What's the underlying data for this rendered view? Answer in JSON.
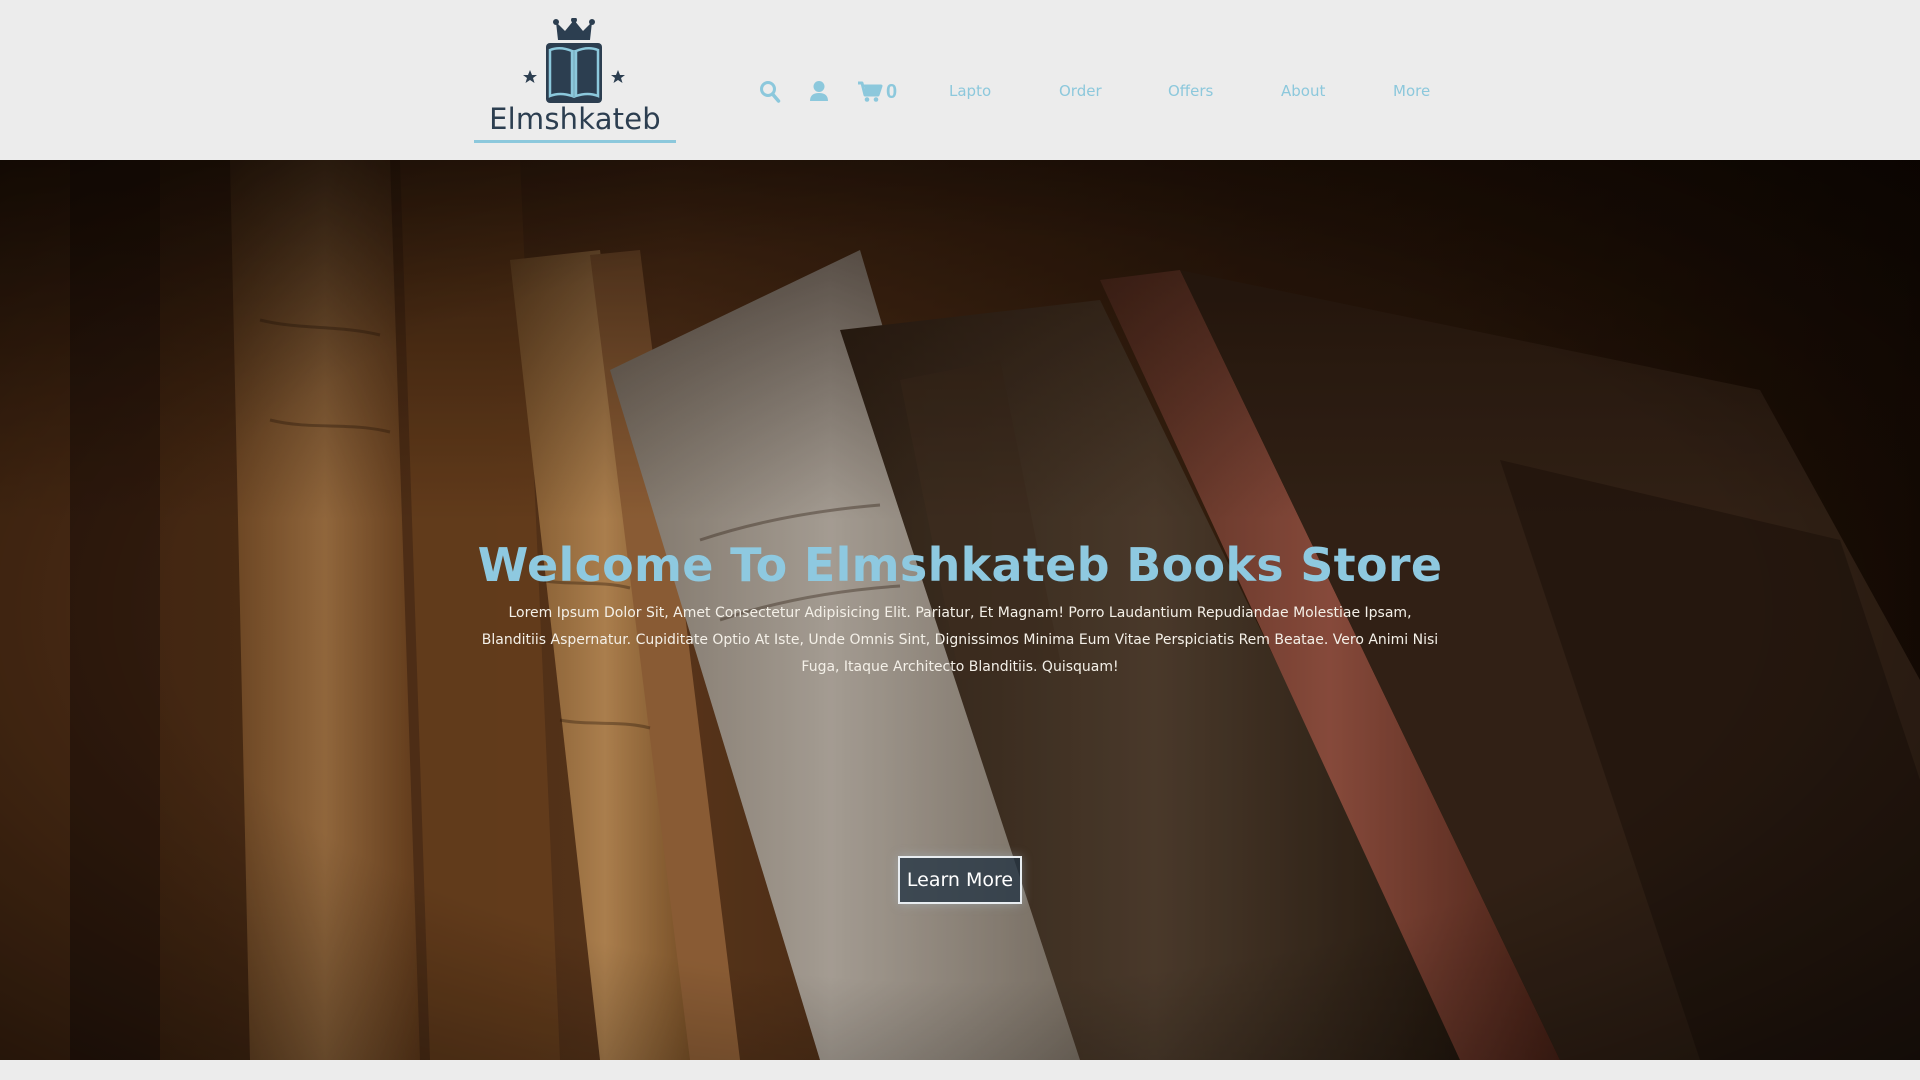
{
  "brand": {
    "name": "Elmshkateb",
    "logo_icon": "crowned-book-icon"
  },
  "nav": {
    "icons": [
      {
        "name": "search-icon"
      },
      {
        "name": "user-icon"
      },
      {
        "name": "cart-icon"
      }
    ],
    "cart_count": "0",
    "links": [
      "Lapto",
      "Order",
      "Offers",
      "About",
      "More"
    ]
  },
  "hero": {
    "title": "Welcome To Elmshkateb Books Store",
    "text": "Lorem Ipsum Dolor Sit, Amet Consectetur Adipisicing Elit. Pariatur, Et Magnam! Porro Laudantium Repudiandae Molestiae Ipsam, Blanditiis Aspernatur. Cupiditate Optio At Iste, Unde Omnis Sint, Dignissimos Minima Eum Vitae Perspiciatis Rem Beatae. Vero Animi Nisi Fuga, Itaque Architecto Blanditiis. Quisquam!",
    "button_label": "Learn More",
    "background": "old-books-photo"
  },
  "colors": {
    "accent": "#8cc8dc",
    "brand_dark": "#2c3e50",
    "header_bg": "#ececec",
    "title": "#8ec9e0"
  }
}
